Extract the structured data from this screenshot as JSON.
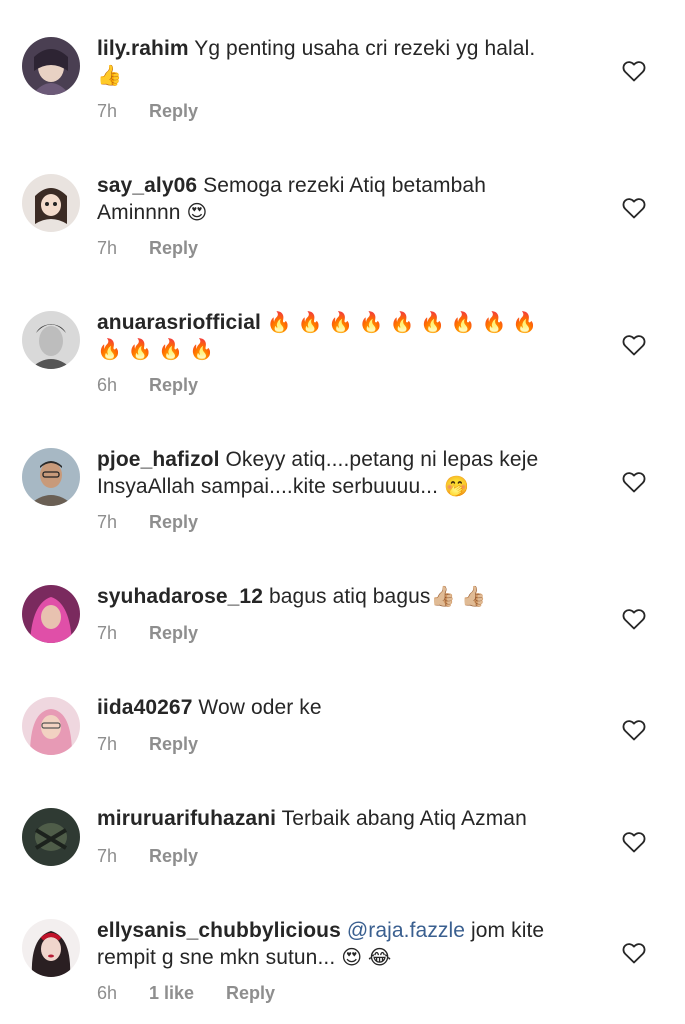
{
  "comments": [
    {
      "username": "lily.rahim",
      "text": "Yg penting usaha cri rezeki yg halal.",
      "text2": "",
      "emoji": "👍",
      "time": "7h",
      "likes": "",
      "reply": "Reply"
    },
    {
      "username": "say_aly06",
      "text": "Semoga rezeki Atiq betambah",
      "text2": "Aminnnn",
      "emoji": "😍",
      "time": "7h",
      "likes": "",
      "reply": "Reply"
    },
    {
      "username": "anuarasriofficial",
      "text": "",
      "text2": "",
      "emoji": "🔥 🔥 🔥 🔥 🔥 🔥 🔥 🔥 🔥",
      "emoji2": "🔥 🔥 🔥 🔥",
      "time": "6h",
      "likes": "",
      "reply": "Reply"
    },
    {
      "username": "pjoe_hafizol",
      "text": "Okeyy atiq....petang ni lepas keje",
      "text2": "InsyaAllah sampai....kite serbuuuu...",
      "emoji": "🤭",
      "time": "7h",
      "likes": "",
      "reply": "Reply"
    },
    {
      "username": "syuhadarose_12",
      "text": "bagus atiq bagus",
      "text2": "",
      "emoji": "👍🏼 👍🏼",
      "time": "7h",
      "likes": "",
      "reply": "Reply"
    },
    {
      "username": "iida40267",
      "text": "Wow oder ke",
      "text2": "",
      "emoji": "",
      "time": "7h",
      "likes": "",
      "reply": "Reply"
    },
    {
      "username": "miruruarifuhazani",
      "text": "Terbaik abang Atiq Azman",
      "text2": "",
      "emoji": "",
      "time": "7h",
      "likes": "",
      "reply": "Reply"
    },
    {
      "username": "ellysanis_chubbylicious",
      "mention": "@raja.fazzle",
      "text": "jom kite",
      "text2": "rempit g sne mkn sutun...",
      "emoji": "😍 😂",
      "time": "6h",
      "likes": "1 like",
      "reply": "Reply"
    }
  ],
  "icons": {
    "heart": "heart-outline-icon",
    "heart_color": "#262626"
  }
}
